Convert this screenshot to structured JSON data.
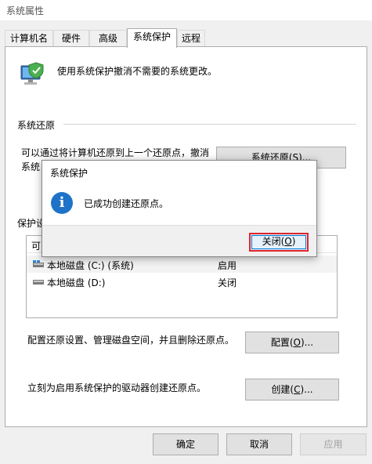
{
  "window": {
    "title": "系统属性"
  },
  "tabs": [
    {
      "label": "计算机名"
    },
    {
      "label": "硬件"
    },
    {
      "label": "高级"
    },
    {
      "label": "系统保护"
    },
    {
      "label": "远程"
    }
  ],
  "intro": "使用系统保护撤消不需要的系统更改。",
  "restore_group": {
    "label": "系统还原",
    "text_line1": "可以通过将计算机还原到上一个还原点，撤消",
    "text_line2_prefix": "系统",
    "button_label_prefix": "系统还原(",
    "button_hotkey": "S",
    "button_label_suffix": ")..."
  },
  "protection_group": {
    "label_prefix": "保护设",
    "list_header_prefix": "可",
    "drives": [
      {
        "name": "本地磁盘 (C:) (系统)",
        "state": "启用",
        "icon": "system-drive-icon"
      },
      {
        "name": "本地磁盘 (D:)",
        "state": "关闭",
        "icon": "drive-icon"
      }
    ]
  },
  "configure": {
    "text": "配置还原设置、管理磁盘空间，并且删除还原点。",
    "button_prefix": "配置(",
    "button_hotkey": "O",
    "button_suffix": ")..."
  },
  "create": {
    "text": "立刻为启用系统保护的驱动器创建还原点。",
    "button_prefix": "创建(",
    "button_hotkey": "C",
    "button_suffix": ")..."
  },
  "footer": {
    "ok": "确定",
    "cancel": "取消",
    "apply": "应用"
  },
  "dialog": {
    "title": "系统保护",
    "message": "已成功创建还原点。",
    "icon": "info-icon",
    "close_prefix": "关闭(",
    "close_hotkey": "O",
    "close_suffix": ")",
    "highlight_color": "#e0242b"
  }
}
